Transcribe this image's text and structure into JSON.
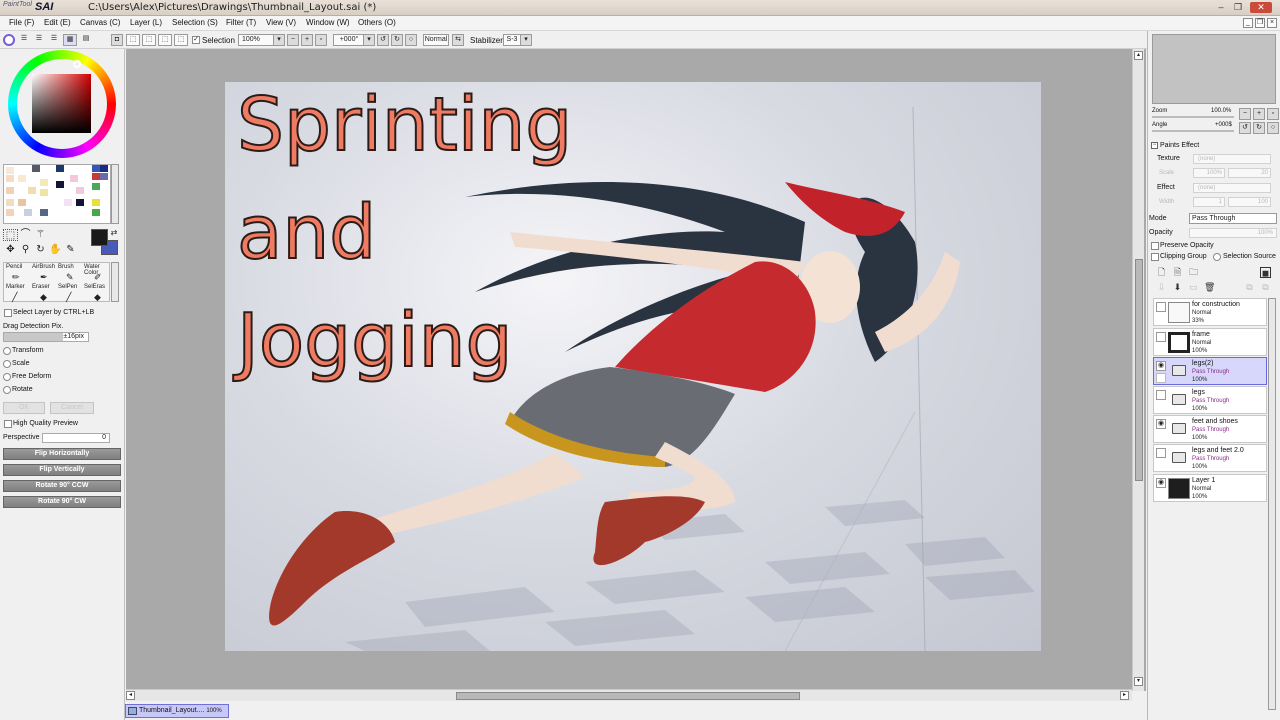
{
  "app": {
    "logo_small": "PaintTool",
    "logo_big": "SAI",
    "title": "C:\\Users\\Alex\\Pictures\\Drawings\\Thumbnail_Layout.sai (*)"
  },
  "menu": [
    "File (F)",
    "Edit (E)",
    "Canvas (C)",
    "Layer (L)",
    "Selection (S)",
    "Filter (T)",
    "View (V)",
    "Window (W)",
    "Others (O)"
  ],
  "toolbar": {
    "selection_label": "Selection",
    "zoom": "100%",
    "rotation": "+000°",
    "blend": "Normal",
    "stabilizer_label": "Stabilizer",
    "stabilizer_value": "S-3"
  },
  "tools": {
    "brushes": [
      "Pencil",
      "AirBrush",
      "Brush",
      "Water Color",
      "Marker",
      "Eraser",
      "SelPen",
      "SelEras"
    ],
    "select_layer_ctrl": "Select Layer by CTRL+LB",
    "drag_detection_label": "Drag Detection Pix.",
    "drag_detection_value": "±16pix",
    "transform_options": [
      "Transform",
      "Scale",
      "Free Deform",
      "Rotate"
    ],
    "ok_label": "OK",
    "cancel_label": "Cancel",
    "hq_preview": "High Quality Preview",
    "perspective_label": "Perspective",
    "perspective_value": "0",
    "flip_h": "Flip Horizontally",
    "flip_v": "Flip Vertically",
    "rot_ccw": "Rotate 90° CCW",
    "rot_cw": "Rotate 90° CW"
  },
  "artwork": {
    "line1": "Sprinting",
    "line2": "and",
    "line3": "Jogging"
  },
  "document_tab": {
    "name": "Thumbnail_Layout....",
    "zoom": "100%"
  },
  "navigator": {
    "zoom_label": "Zoom",
    "zoom_value": "100.0%",
    "angle_label": "Angle",
    "angle_value": "+000$"
  },
  "paints_effect": {
    "header": "Paints Effect",
    "texture_label": "Texture",
    "texture_value": "(none)",
    "scale_label": "Scale",
    "scale_value": "100%",
    "scale_num": "20",
    "effect_label": "Effect",
    "effect_value": "(none)",
    "width_label": "Width",
    "width_value": "1",
    "width_num": "100"
  },
  "layer_props": {
    "mode_label": "Mode",
    "mode_value": "Pass Through",
    "opacity_label": "Opacity",
    "opacity_value": "100%",
    "preserve_opacity": "Preserve Opacity",
    "clipping_group": "Clipping Group",
    "selection_source": "Selection Source"
  },
  "layers": [
    {
      "name": "for construction",
      "mode": "Normal",
      "opacity": "33%",
      "visible": false,
      "kind": "light"
    },
    {
      "name": "frame",
      "mode": "Normal",
      "opacity": "100%",
      "visible": false,
      "kind": "frame"
    },
    {
      "name": "legs(2)",
      "mode": "Pass Through",
      "opacity": "100%",
      "visible": true,
      "kind": "folder"
    },
    {
      "name": "legs",
      "mode": "Pass Through",
      "opacity": "100%",
      "visible": false,
      "kind": "folder"
    },
    {
      "name": "feet and shoes",
      "mode": "Pass Through",
      "opacity": "100%",
      "visible": true,
      "kind": "folder"
    },
    {
      "name": "legs and feet 2.0",
      "mode": "Pass Through",
      "opacity": "100%",
      "visible": false,
      "kind": "folder"
    },
    {
      "name": "Layer 1",
      "mode": "Normal",
      "opacity": "100%",
      "visible": true,
      "kind": "dark"
    }
  ],
  "colors": {
    "accent_selected": "#d7d7fb",
    "text_art": "#ee7b62",
    "primary_color": "#1a1a1a",
    "secondary_color": "#4a5ab8"
  }
}
